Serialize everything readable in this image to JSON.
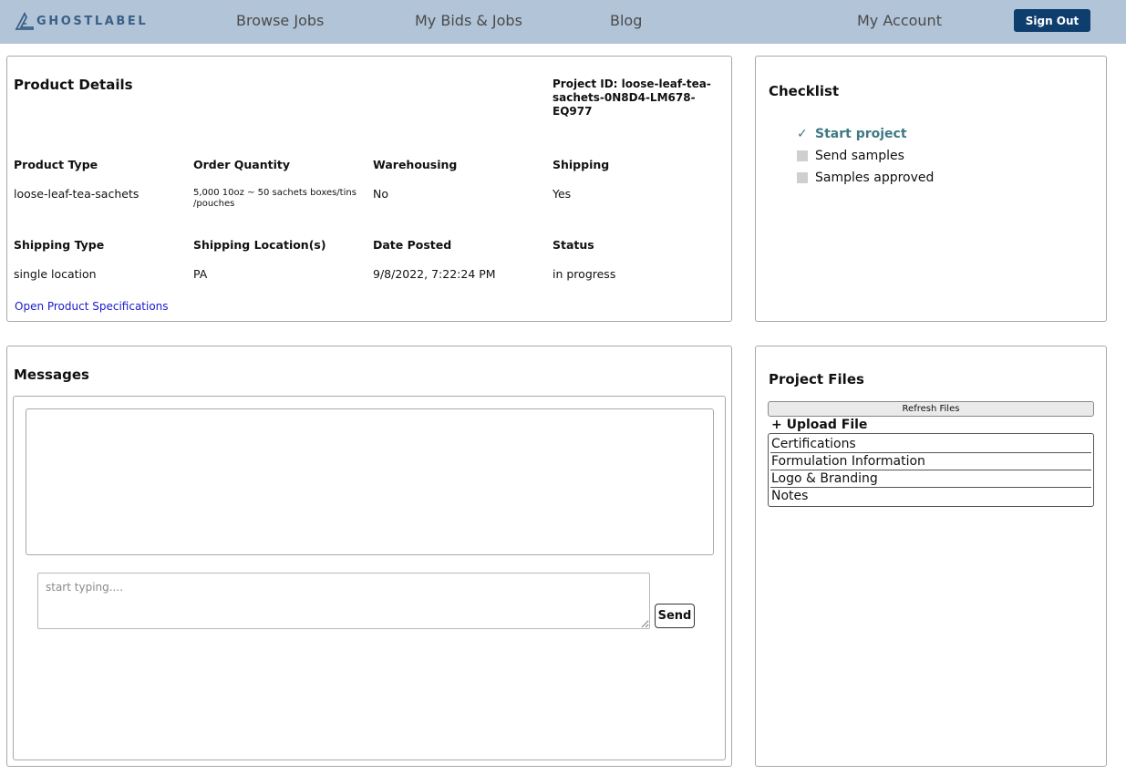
{
  "header": {
    "logo_text": "GHOSTLABEL",
    "nav": [
      "Browse Jobs",
      "My Bids & Jobs",
      "Blog",
      "My Account"
    ],
    "sign_out": "Sign Out",
    "bg_color": "#b2c4d8"
  },
  "details": {
    "title": "Product Details",
    "project_id": "Project ID: loose-leaf-tea-sachets-0N8D4-LM678-EQ977",
    "fields": [
      {
        "label": "Product Type",
        "value": "loose-leaf-tea-sachets"
      },
      {
        "label": "Order Quantity",
        "value": "5,000 10oz ~ 50 sachets boxes/tins /pouches"
      },
      {
        "label": "Warehousing",
        "value": "No"
      },
      {
        "label": "Shipping",
        "value": "Yes"
      },
      {
        "label": "Shipping Type",
        "value": "single location"
      },
      {
        "label": "Shipping Location(s)",
        "value": "PA"
      },
      {
        "label": "Date Posted",
        "value": "9/8/2022, 7:22:24 PM"
      },
      {
        "label": "Status",
        "value": "in progress"
      }
    ],
    "spec_link": "Open Product Specifications"
  },
  "checklist": {
    "title": "Checklist",
    "items": [
      {
        "label": "Start project",
        "done": true
      },
      {
        "label": "Send samples",
        "done": false
      },
      {
        "label": "Samples approved",
        "done": false
      }
    ]
  },
  "messages": {
    "title": "Messages",
    "placeholder": "start typing....",
    "send_label": "Send"
  },
  "files": {
    "title": "Project Files",
    "refresh_label": "Refresh Files",
    "upload_label": "+ Upload File",
    "folders": [
      "Certifications",
      "Formulation Information",
      "Logo & Branding",
      "Notes"
    ]
  }
}
